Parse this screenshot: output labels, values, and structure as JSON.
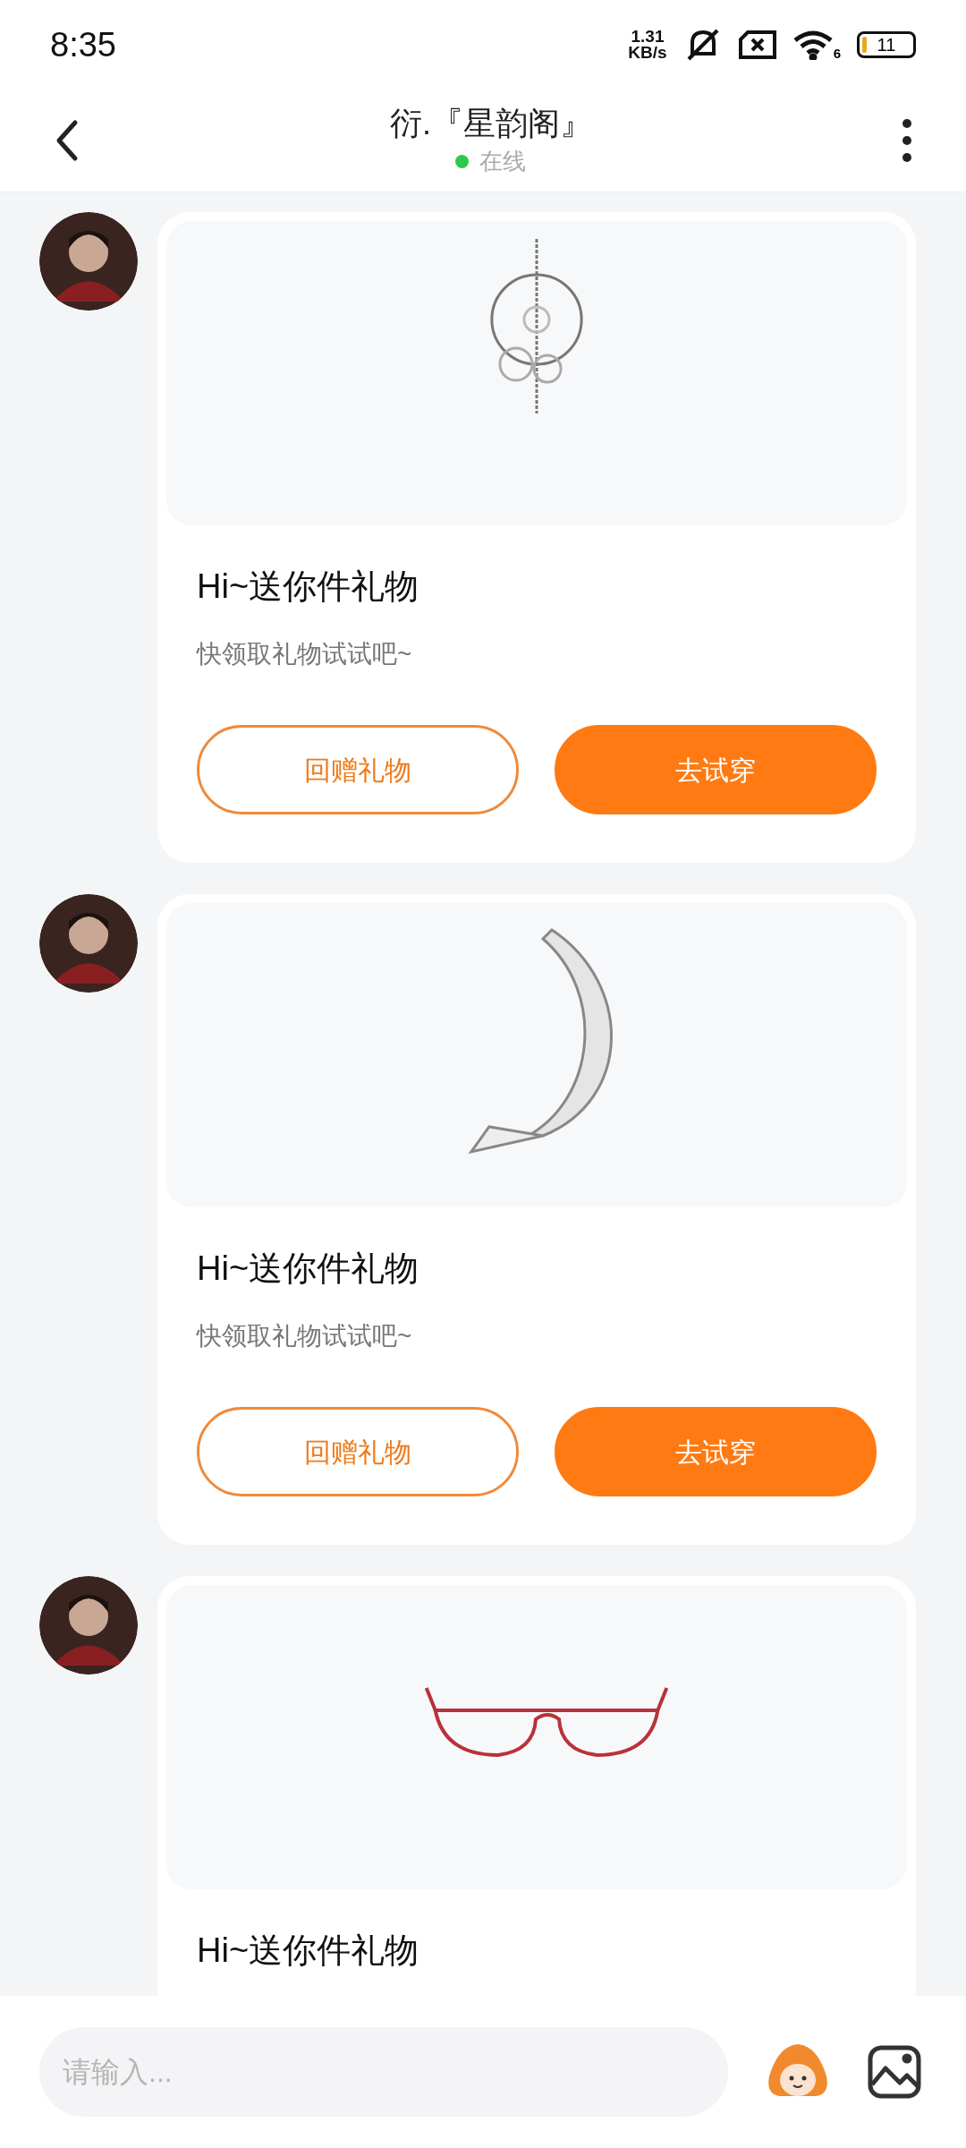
{
  "status_bar": {
    "time": "8:35",
    "net_speed": "1.31",
    "net_unit": "KB/s",
    "wifi_badge": "6",
    "battery": "11"
  },
  "header": {
    "title": "衍.『星韵阁』",
    "online": true,
    "status": "在线"
  },
  "messages": [
    {
      "gift": {
        "kind": "ring"
      },
      "title": "Hi~送你件礼物",
      "subtitle": "快领取礼物试试吧~",
      "buttons": [
        {
          "label": "回赠礼物",
          "kind": "outline"
        },
        {
          "label": "去试穿",
          "kind": "filled"
        }
      ]
    },
    {
      "gift": {
        "kind": "tail"
      },
      "title": "Hi~送你件礼物",
      "subtitle": "快领取礼物试试吧~",
      "buttons": [
        {
          "label": "回赠礼物",
          "kind": "outline"
        },
        {
          "label": "去试穿",
          "kind": "filled"
        }
      ]
    },
    {
      "gift": {
        "kind": "glasses"
      },
      "title": "Hi~送你件礼物"
    }
  ],
  "composer": {
    "placeholder": "请输入..."
  }
}
